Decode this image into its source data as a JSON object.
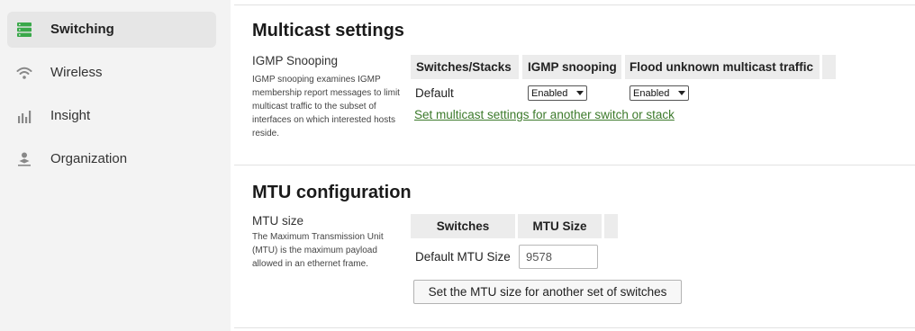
{
  "sidebar": {
    "items": [
      {
        "label": "Switching",
        "icon": "switching-icon",
        "active": true
      },
      {
        "label": "Wireless",
        "icon": "wifi-icon",
        "active": false
      },
      {
        "label": "Insight",
        "icon": "bar-chart-icon",
        "active": false
      },
      {
        "label": "Organization",
        "icon": "organization-icon",
        "active": false
      }
    ]
  },
  "multicast": {
    "title": "Multicast settings",
    "field_title": "IGMP Snooping",
    "description": "IGMP snooping examines IGMP membership report messages to limit multicast traffic to the subset of interfaces on which interested hosts reside.",
    "columns": [
      "Switches/Stacks",
      "IGMP snooping",
      "Flood unknown multicast traffic"
    ],
    "row": {
      "name": "Default",
      "igmp_snooping": "Enabled",
      "flood_unknown": "Enabled"
    },
    "add_link": "Set multicast settings for another switch or stack"
  },
  "mtu": {
    "title": "MTU configuration",
    "field_title": "MTU size",
    "description": "The Maximum Transmission Unit (MTU) is the maximum payload allowed in an ethernet frame.",
    "columns": [
      "Switches",
      "MTU Size"
    ],
    "row_label": "Default MTU Size",
    "mtu_value": "9578",
    "add_button": "Set the MTU size for another set of switches"
  },
  "colors": {
    "link": "#3c7a2b",
    "sidebar_bg": "#f3f3f3",
    "active_item_bg": "#e6e6e6",
    "icon_green": "#3aa84a"
  }
}
